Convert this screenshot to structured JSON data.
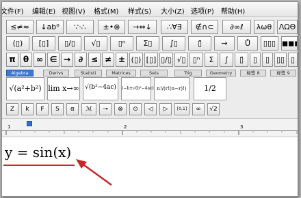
{
  "menubar": {
    "items": [
      "文件(F)",
      "编辑(E)",
      "视图(V)",
      "格式(M)",
      "样式(S)",
      "大小(Z)",
      "选项(P)",
      "帮助(H)"
    ]
  },
  "palette": {
    "row1": [
      "≤≠≈",
      "↓ab⁰",
      "∵·∴",
      "±•⊗",
      "→⇔↓",
      "∴∀∃",
      "∉∩⊂",
      "∂∞ℓ",
      "λωθ",
      "ΛΩΘ"
    ],
    "row2": [
      "(▯)",
      "[▯]",
      "▯/▯",
      "√▯",
      "▯ⁿ",
      "Σ▯",
      "∫▯",
      "▯̄",
      "→",
      "Ů",
      "▯▯▯",
      "◼◼◼"
    ],
    "row3": [
      "π",
      "θ",
      "∞",
      "∈",
      "→",
      "∂",
      "≤",
      "≠",
      "±",
      "(▯)",
      "[▯]",
      "▯/▯",
      "√▯",
      "▯ⁿ",
      "Σ",
      "∫",
      "▯̄",
      "▯",
      "▯",
      "▯▯",
      "▯"
    ],
    "tabs": [
      "Algebra",
      "Derivs",
      "Statisti",
      "Matrices",
      "Sets",
      "Trig",
      "Geometry",
      "标签 8",
      "标签 9"
    ],
    "templates": [
      "√(a²+b²)",
      "lim x→∞",
      "√(b²−4ac)",
      "(−b±√(b²−4ac))/2a",
      "n!/(r!(n−r)!)",
      "1/2"
    ],
    "row5": [
      "Z",
      "k",
      "F",
      "S",
      "α",
      "ℳ",
      "⊸",
      "⊗",
      "⊙",
      "◁",
      "▷",
      "[0,1]",
      "∞",
      "√2"
    ]
  },
  "ruler": {
    "numbers": [
      "1",
      "2",
      "3"
    ]
  },
  "document": {
    "formula": "y = sin(x)"
  },
  "colors": {
    "underline": "#c9262a",
    "arrow": "#c9262a",
    "tab_active": "#3b78d0"
  }
}
